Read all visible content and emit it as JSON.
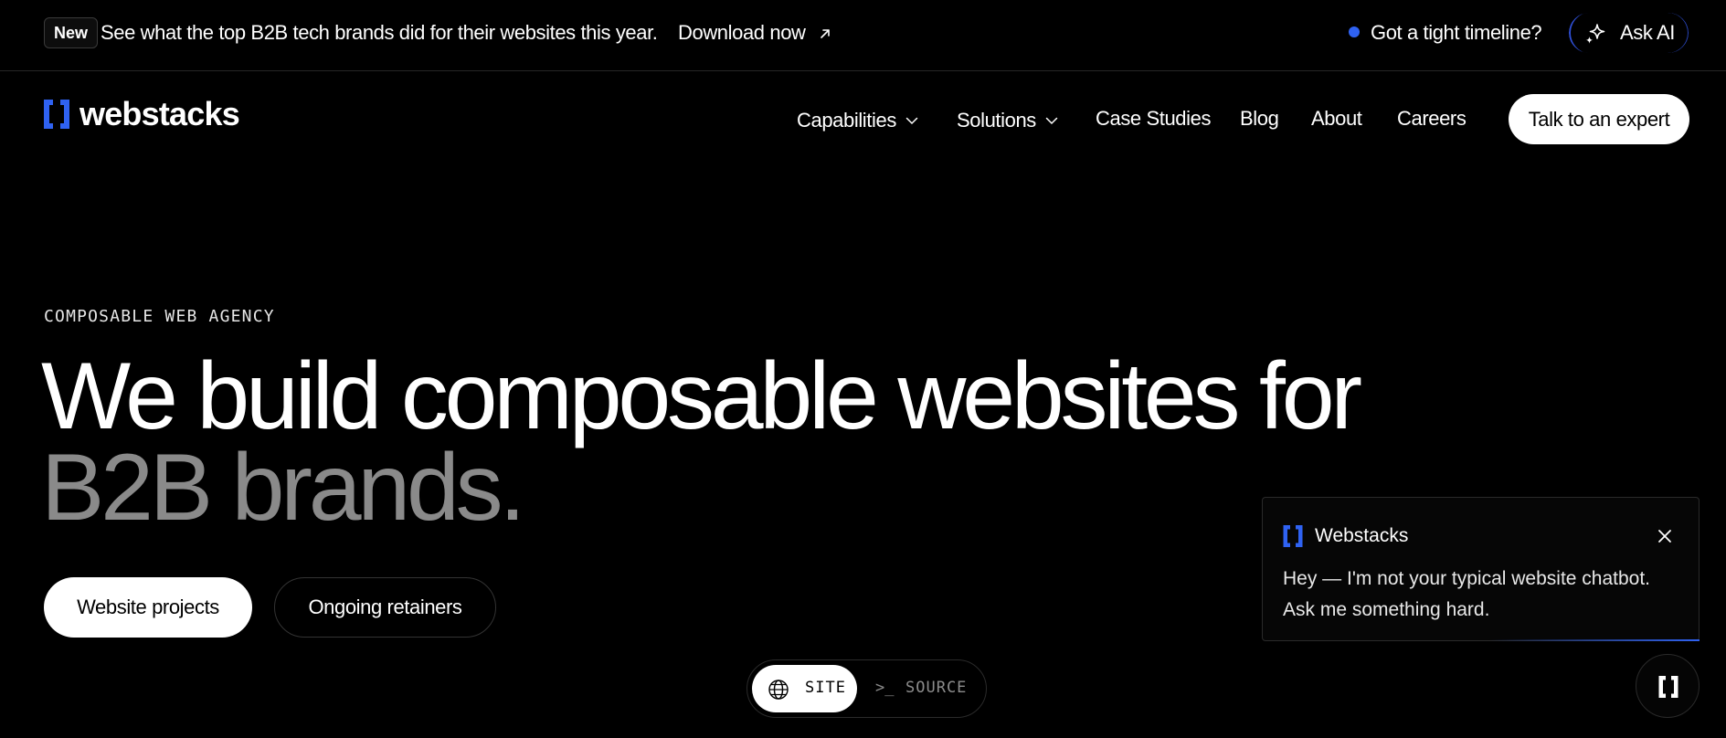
{
  "announcement": {
    "badge": "New",
    "text": "See what the top B2B tech brands did for their websites this year.",
    "link_label": "Download now",
    "link_icon": "arrow-up-right-icon",
    "timeline_label": "Got a tight timeline?",
    "ask_ai_label": "Ask AI",
    "ask_ai_icon": "sparkle-icon"
  },
  "brand": {
    "name": "webstacks",
    "accent_color": "#2f62f2"
  },
  "nav": {
    "items": [
      {
        "label": "Capabilities",
        "has_dropdown": true
      },
      {
        "label": "Solutions",
        "has_dropdown": true
      },
      {
        "label": "Case Studies",
        "has_dropdown": false
      },
      {
        "label": "Blog",
        "has_dropdown": false
      },
      {
        "label": "About",
        "has_dropdown": false
      },
      {
        "label": "Careers",
        "has_dropdown": false
      }
    ],
    "cta_label": "Talk to an expert"
  },
  "hero": {
    "eyebrow": "COMPOSABLE WEB AGENCY",
    "headline_line1": "We build composable websites for",
    "headline_line2": "B2B brands.",
    "primary_button": "Website projects",
    "secondary_button": "Ongoing retainers"
  },
  "view_toggle": {
    "site_label": "SITE",
    "source_prompt": ">_",
    "source_label": "SOURCE",
    "selected": "SITE"
  },
  "chat": {
    "title": "Webstacks",
    "message": "Hey — I'm not your typical website chatbot. Ask me something hard."
  }
}
